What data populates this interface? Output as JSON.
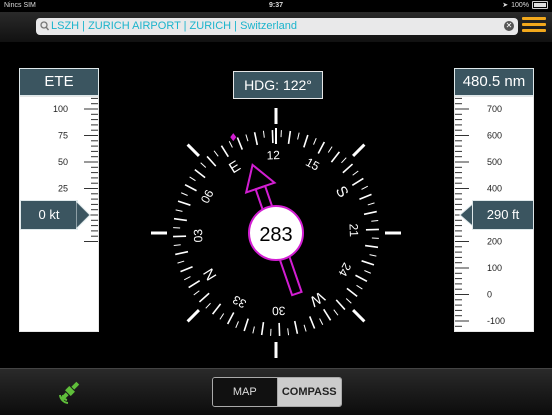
{
  "status_bar": {
    "carrier": "Nincs SIM",
    "time": "9:37",
    "battery": "100%"
  },
  "search": {
    "value": "LSZH | ZURICH AIRPORT | ZURICH | Switzerland"
  },
  "ete": {
    "header": "ETE",
    "speed": "0 kt",
    "tape_labels": [
      "100",
      "75",
      "50",
      "25",
      "0"
    ]
  },
  "distance": {
    "header": "480.5 nm",
    "altitude": "290 ft",
    "tape_labels": [
      "700",
      "600",
      "500",
      "400",
      "300",
      "200",
      "100",
      "0",
      "-100"
    ]
  },
  "compass": {
    "heading_label": "HDG: 122°",
    "readout": "283",
    "dial_labels": [
      "E",
      "12",
      "15",
      "S",
      "21",
      "24",
      "W",
      "30",
      "33",
      "N",
      "03",
      "06"
    ],
    "colors": {
      "needle": "#d21ed2",
      "panel": "#3b5560",
      "accent": "#1bb4cc",
      "menu": "#f2a81c"
    }
  },
  "modes": {
    "map": "MAP",
    "compass": "COMPASS",
    "active": "compass"
  }
}
